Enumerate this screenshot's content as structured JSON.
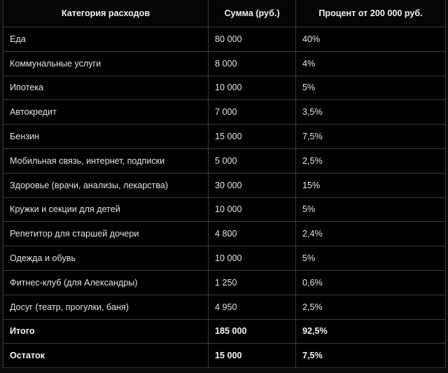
{
  "table": {
    "headers": [
      "Категория расходов",
      "Сумма (руб.)",
      "Процент от 200 000 руб."
    ],
    "rows": [
      {
        "category": "Еда",
        "amount": "80 000",
        "percent": "40%"
      },
      {
        "category": "Коммунальные услуги",
        "amount": "8 000",
        "percent": "4%"
      },
      {
        "category": "Ипотека",
        "amount": "10 000",
        "percent": "5%"
      },
      {
        "category": "Автокредит",
        "amount": "7 000",
        "percent": "3,5%"
      },
      {
        "category": "Бензин",
        "amount": "15 000",
        "percent": "7,5%"
      },
      {
        "category": "Мобильная связь, интернет, подписки",
        "amount": "5 000",
        "percent": "2,5%"
      },
      {
        "category": "Здоровье (врачи, анализы, лекарства)",
        "amount": "30 000",
        "percent": "15%"
      },
      {
        "category": "Кружки и секции для детей",
        "amount": "10 000",
        "percent": "5%"
      },
      {
        "category": "Репетитор для старшей дочери",
        "amount": "4 800",
        "percent": "2,4%"
      },
      {
        "category": "Одежда и обувь",
        "amount": "10 000",
        "percent": "5%"
      },
      {
        "category": "Фитнес-клуб (для Александры)",
        "amount": "1 250",
        "percent": "0,6%"
      },
      {
        "category": "Досуг (театр, прогулки, баня)",
        "amount": "4 950",
        "percent": "2,5%"
      },
      {
        "category": "Итого",
        "amount": "185 000",
        "percent": "92,5%"
      },
      {
        "category": "Остаток",
        "amount": "15 000",
        "percent": "7,5%"
      }
    ]
  }
}
